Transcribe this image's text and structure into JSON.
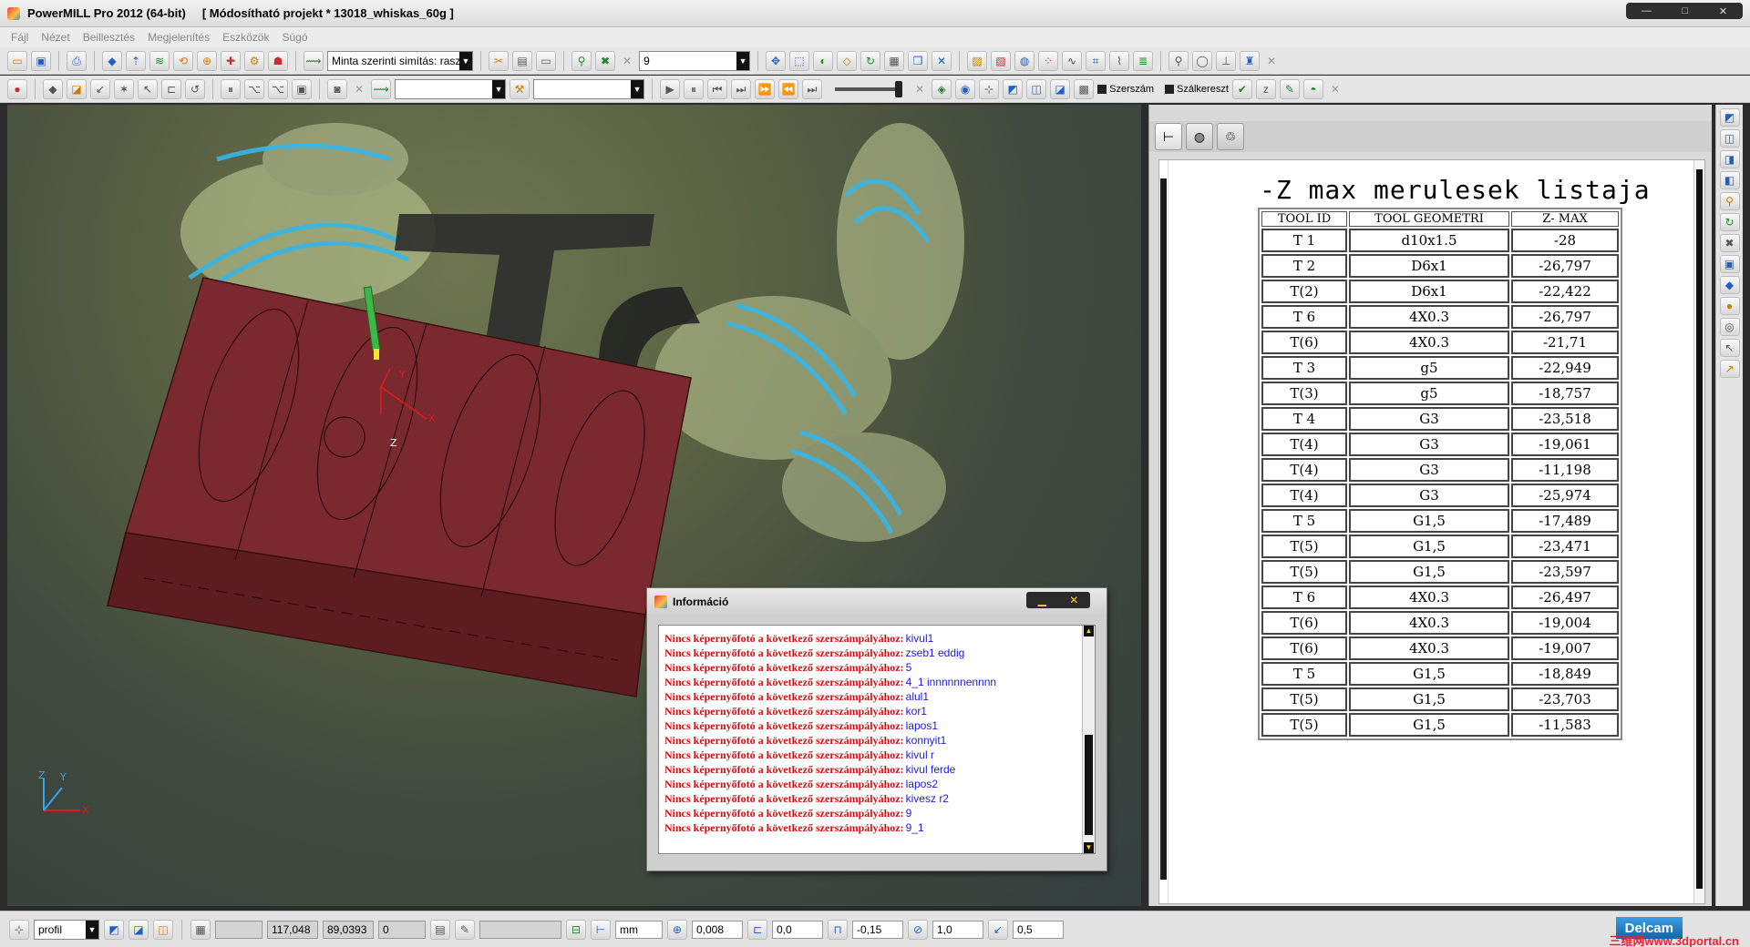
{
  "window": {
    "title": "PowerMILL Pro 2012 (64-bit)",
    "project": "[ Módosítható projekt * 13018_whiskas_60g ]",
    "controls": [
      "—",
      "□",
      "✕"
    ]
  },
  "menu": [
    "Fájl",
    "Nézet",
    "Beillesztés",
    "Megjelenítés",
    "Eszközök",
    "Súgó"
  ],
  "toolbar1": {
    "strategy_combo": "Minta szerinti simítás: raszte",
    "number_combo": "9"
  },
  "toolbar2": {
    "combo_a": "",
    "combo_b": "",
    "tool_label": "Szerszám",
    "holder_label": "Szálkereszt"
  },
  "viewport": {
    "axis_labels": {
      "x": "X",
      "y": "Y",
      "z": "Z"
    },
    "colors": {
      "part": "#7a2a2e",
      "background": "#4a5340",
      "rings": "#37b6e8"
    }
  },
  "right_panel": {
    "doc_title": "-Z max merulesek listaja",
    "table": {
      "headers": [
        "TOOL ID",
        "TOOL GEOMETRI",
        "Z- MAX"
      ],
      "rows": [
        [
          "T 1",
          "d10x1.5",
          "-28"
        ],
        [
          "T 2",
          "D6x1",
          "-26,797"
        ],
        [
          "T(2)",
          "D6x1",
          "-22,422"
        ],
        [
          "T 6",
          "4X0.3",
          "-26,797"
        ],
        [
          "T(6)",
          "4X0.3",
          "-21,71"
        ],
        [
          "T 3",
          "g5",
          "-22,949"
        ],
        [
          "T(3)",
          "g5",
          "-18,757"
        ],
        [
          "T 4",
          "G3",
          "-23,518"
        ],
        [
          "T(4)",
          "G3",
          "-19,061"
        ],
        [
          "T(4)",
          "G3",
          "-11,198"
        ],
        [
          "T(4)",
          "G3",
          "-25,974"
        ],
        [
          "T 5",
          "G1,5",
          "-17,489"
        ],
        [
          "T(5)",
          "G1,5",
          "-23,471"
        ],
        [
          "T(5)",
          "G1,5",
          "-23,597"
        ],
        [
          "T 6",
          "4X0.3",
          "-26,497"
        ],
        [
          "T(6)",
          "4X0.3",
          "-19,004"
        ],
        [
          "T(6)",
          "4X0.3",
          "-19,007"
        ],
        [
          "T 5",
          "G1,5",
          "-18,849"
        ],
        [
          "T(5)",
          "G1,5",
          "-23,703"
        ],
        [
          "T(5)",
          "G1,5",
          "-11,583"
        ]
      ]
    }
  },
  "dialog": {
    "title": "Információ",
    "message_prefix": "Nincs képernyőfotó a következő szerszámpályához:",
    "lines": [
      "kivul1",
      "zseb1 eddig",
      "5",
      "4_1 innnnnnennnn",
      "alul1",
      "kor1",
      "lapos1",
      "konnyit1",
      "kivul r",
      "kivul ferde",
      "lapos2",
      "kivesz r2",
      "9",
      "9_1"
    ]
  },
  "statusbar": {
    "workplane_combo": "profil",
    "fields": {
      "blank": "",
      "x": "117,048",
      "y": "89,0393",
      "z": "0",
      "blank2": "",
      "units": "mm",
      "tolerance": "0,008",
      "thickness": "0,0",
      "axial": "-0,15",
      "stepover": "1,0",
      "stepdown": "0,5"
    },
    "brand": "Delcam",
    "watermark": "三维网www.3dportal.cn"
  }
}
